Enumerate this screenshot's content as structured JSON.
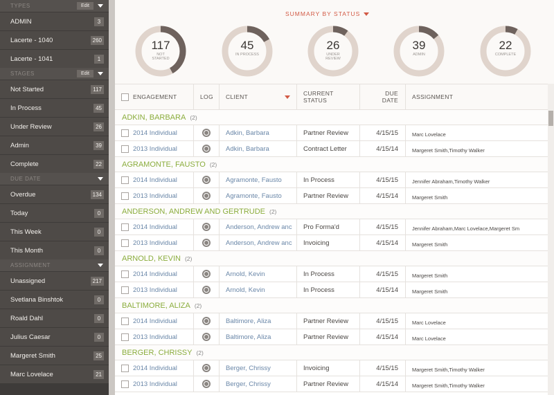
{
  "sidebar": {
    "types": {
      "title": "TYPES",
      "edit": "Edit",
      "items": [
        {
          "label": "ADMIN",
          "count": "3"
        },
        {
          "label": "Lacerte - 1040",
          "count": "260"
        },
        {
          "label": "Lacerte - 1041",
          "count": "1"
        }
      ]
    },
    "stages": {
      "title": "STAGES",
      "edit": "Edit",
      "items": [
        {
          "label": "Not Started",
          "count": "117"
        },
        {
          "label": "In Process",
          "count": "45"
        },
        {
          "label": "Under Review",
          "count": "26"
        },
        {
          "label": "Admin",
          "count": "39"
        },
        {
          "label": "Complete",
          "count": "22"
        }
      ]
    },
    "due_date": {
      "title": "DUE DATE",
      "items": [
        {
          "label": "Overdue",
          "count": "134"
        },
        {
          "label": "Today",
          "count": "0"
        },
        {
          "label": "This Week",
          "count": "0"
        },
        {
          "label": "This Month",
          "count": "0"
        }
      ]
    },
    "assignment": {
      "title": "ASSIGNMENT",
      "items": [
        {
          "label": "Unassigned",
          "count": "217"
        },
        {
          "label": "Svetlana Binshtok",
          "count": "0"
        },
        {
          "label": "Roald Dahl",
          "count": "0"
        },
        {
          "label": "Julius Caesar",
          "count": "0"
        },
        {
          "label": "Margeret Smith",
          "count": "25"
        },
        {
          "label": "Marc Lovelace",
          "count": "21"
        }
      ]
    }
  },
  "summary": {
    "title": "SUMMARY BY STATUS",
    "accent_color": "#d25a45",
    "ring_track_color": "#e0d4cc",
    "ring_fill_color": "#6e625d",
    "stats": [
      {
        "value": "117",
        "label_lines": [
          "NOT",
          "STARTED"
        ],
        "fraction": 0.42
      },
      {
        "value": "45",
        "label_lines": [
          "IN PROCESS"
        ],
        "fraction": 0.17
      },
      {
        "value": "26",
        "label_lines": [
          "UNDER",
          "REVIEW"
        ],
        "fraction": 0.1
      },
      {
        "value": "39",
        "label_lines": [
          "ADMIN"
        ],
        "fraction": 0.14
      },
      {
        "value": "22",
        "label_lines": [
          "COMPLETE"
        ],
        "fraction": 0.08
      }
    ]
  },
  "table": {
    "headers": {
      "engagement": "ENGAGEMENT",
      "log": "LOG",
      "client": "CLIENT",
      "current_status": [
        "CURRENT",
        "STATUS"
      ],
      "due_date": [
        "DUE",
        "DATE"
      ],
      "assignment": "ASSIGNMENT"
    },
    "group_name_color": "#8bad3d",
    "link_color": "#6a87a8",
    "groups": [
      {
        "name": "ADKIN, BARBARA",
        "count": "(2)",
        "rows": [
          {
            "engagement": "2014 Individual",
            "client": "Adkin, Barbara",
            "status": "Partner Review",
            "due": "4/15/15",
            "assignment": "Marc Lovelace"
          },
          {
            "engagement": "2013 Individual",
            "client": "Adkin, Barbara",
            "status": "Contract Letter",
            "due": "4/15/14",
            "assignment": "Margeret Smith,Timothy Walker"
          }
        ]
      },
      {
        "name": "AGRAMONTE, FAUSTO",
        "count": "(2)",
        "rows": [
          {
            "engagement": "2014 Individual",
            "client": "Agramonte, Fausto",
            "status": "In Process",
            "due": "4/15/15",
            "assignment": "Jennifer Abraham,Timothy Walker"
          },
          {
            "engagement": "2013 Individual",
            "client": "Agramonte, Fausto",
            "status": "Partner Review",
            "due": "4/15/14",
            "assignment": "Margeret Smith"
          }
        ]
      },
      {
        "name": "ANDERSON, ANDREW AND GERTRUDE",
        "count": "(2)",
        "rows": [
          {
            "engagement": "2014 Individual",
            "client": "Anderson, Andrew anc",
            "status": "Pro Forma'd",
            "due": "4/15/15",
            "assignment": "Jennifer Abraham,Marc Lovelace,Margeret Sm"
          },
          {
            "engagement": "2013 Individual",
            "client": "Anderson, Andrew anc",
            "status": "Invoicing",
            "due": "4/15/14",
            "assignment": "Margeret Smith"
          }
        ]
      },
      {
        "name": "ARNOLD, KEVIN",
        "count": "(2)",
        "rows": [
          {
            "engagement": "2014 Individual",
            "client": "Arnold, Kevin",
            "status": "In Process",
            "due": "4/15/15",
            "assignment": "Margeret Smith"
          },
          {
            "engagement": "2013 Individual",
            "client": "Arnold, Kevin",
            "status": "In Process",
            "due": "4/15/14",
            "assignment": "Margeret Smith"
          }
        ]
      },
      {
        "name": "BALTIMORE, ALIZA",
        "count": "(2)",
        "rows": [
          {
            "engagement": "2014 Individual",
            "client": "Baltimore, Aliza",
            "status": "Partner Review",
            "due": "4/15/15",
            "assignment": "Marc Lovelace"
          },
          {
            "engagement": "2013 Individual",
            "client": "Baltimore, Aliza",
            "status": "Partner Review",
            "due": "4/15/14",
            "assignment": "Marc Lovelace"
          }
        ]
      },
      {
        "name": "BERGER, CHRISSY",
        "count": "(2)",
        "rows": [
          {
            "engagement": "2014 Individual",
            "client": "Berger, Chrissy",
            "status": "Invoicing",
            "due": "4/15/15",
            "assignment": "Margeret Smith,Timothy Walker"
          },
          {
            "engagement": "2013 Individual",
            "client": "Berger, Chrissy",
            "status": "Partner Review",
            "due": "4/15/14",
            "assignment": "Margeret Smith,Timothy Walker"
          }
        ]
      }
    ]
  }
}
